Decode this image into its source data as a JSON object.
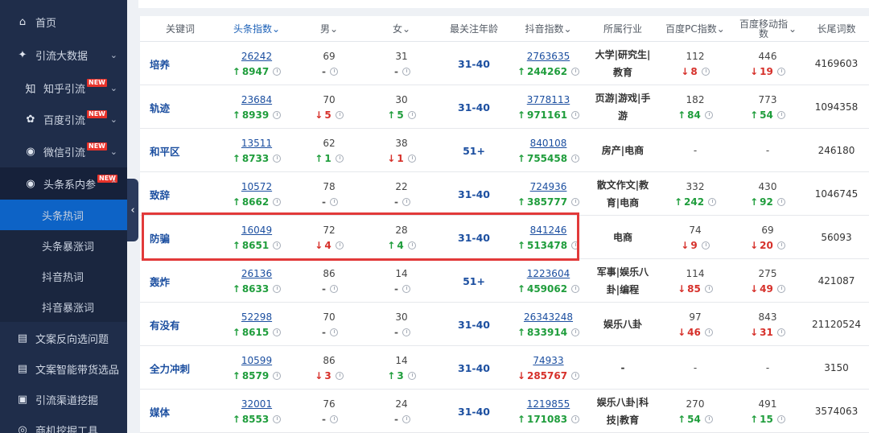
{
  "sidebar": {
    "home": "首页",
    "traffic": "引流大数据",
    "zhihu": "知乎引流",
    "baidu": "百度引流",
    "wechat": "微信引流",
    "toutiao": "头条系内参",
    "new_badge": "NEW",
    "hot": "头条热词",
    "surge": "头条暴涨词",
    "douyin_hot": "抖音热词",
    "douyin_surge": "抖音暴涨词",
    "reverse": "文案反向选问题",
    "smart": "文案智能带货选品",
    "channel": "引流渠道挖掘",
    "biz": "商机挖掘工具"
  },
  "columns": {
    "keyword": "关键词",
    "toutiao": "头条指数",
    "male": "男",
    "female": "女",
    "age": "最关注年龄",
    "douyin": "抖音指数",
    "industry": "所属行业",
    "baidu_pc": "百度PC指数",
    "baidu_mobile": "百度移动指数",
    "longtail": "长尾词数"
  },
  "rows": [
    {
      "kw": "培养",
      "tt": "26242",
      "tt_d": "8947",
      "tt_dir": "up",
      "m": "69",
      "m_d": "-",
      "m_dir": "neutral",
      "f": "31",
      "f_d": "-",
      "f_dir": "neutral",
      "age": "31-40",
      "dy": "2763635",
      "dy_d": "244262",
      "dy_dir": "up",
      "ind": "大学|研究生|教育",
      "pc": "112",
      "pc_d": "8",
      "pc_dir": "down",
      "mo": "446",
      "mo_d": "19",
      "mo_dir": "down",
      "lt": "4169603"
    },
    {
      "kw": "轨迹",
      "tt": "23684",
      "tt_d": "8939",
      "tt_dir": "up",
      "m": "70",
      "m_d": "5",
      "m_dir": "down",
      "f": "30",
      "f_d": "5",
      "f_dir": "up",
      "age": "31-40",
      "dy": "3778113",
      "dy_d": "971161",
      "dy_dir": "up",
      "ind": "页游|游戏|手游",
      "pc": "182",
      "pc_d": "84",
      "pc_dir": "up",
      "mo": "773",
      "mo_d": "54",
      "mo_dir": "up",
      "lt": "1094358"
    },
    {
      "kw": "和平区",
      "tt": "13511",
      "tt_d": "8733",
      "tt_dir": "up",
      "m": "62",
      "m_d": "1",
      "m_dir": "up",
      "f": "38",
      "f_d": "1",
      "f_dir": "down",
      "age": "51+",
      "dy": "840108",
      "dy_d": "755458",
      "dy_dir": "up",
      "ind": "房产|电商",
      "pc": "-",
      "pc_d": "",
      "pc_dir": "none",
      "mo": "-",
      "mo_d": "",
      "mo_dir": "none",
      "lt": "246180"
    },
    {
      "kw": "致辞",
      "tt": "10572",
      "tt_d": "8662",
      "tt_dir": "up",
      "m": "78",
      "m_d": "-",
      "m_dir": "neutral",
      "f": "22",
      "f_d": "-",
      "f_dir": "neutral",
      "age": "31-40",
      "dy": "724936",
      "dy_d": "385777",
      "dy_dir": "up",
      "ind": "散文作文|教育|电商",
      "pc": "332",
      "pc_d": "242",
      "pc_dir": "up",
      "mo": "430",
      "mo_d": "92",
      "mo_dir": "up",
      "lt": "1046745"
    },
    {
      "kw": "防骗",
      "tt": "16049",
      "tt_d": "8651",
      "tt_dir": "up",
      "m": "72",
      "m_d": "4",
      "m_dir": "down",
      "f": "28",
      "f_d": "4",
      "f_dir": "up",
      "age": "31-40",
      "dy": "841246",
      "dy_d": "513478",
      "dy_dir": "up",
      "ind": "电商",
      "pc": "74",
      "pc_d": "9",
      "pc_dir": "down",
      "mo": "69",
      "mo_d": "20",
      "mo_dir": "down",
      "lt": "56093"
    },
    {
      "kw": "轰炸",
      "tt": "26136",
      "tt_d": "8633",
      "tt_dir": "up",
      "m": "86",
      "m_d": "-",
      "m_dir": "neutral",
      "f": "14",
      "f_d": "-",
      "f_dir": "neutral",
      "age": "51+",
      "dy": "1223604",
      "dy_d": "459062",
      "dy_dir": "up",
      "ind": "军事|娱乐八卦|编程",
      "pc": "114",
      "pc_d": "85",
      "pc_dir": "down",
      "mo": "275",
      "mo_d": "49",
      "mo_dir": "down",
      "lt": "421087"
    },
    {
      "kw": "有没有",
      "tt": "52298",
      "tt_d": "8615",
      "tt_dir": "up",
      "m": "70",
      "m_d": "-",
      "m_dir": "neutral",
      "f": "30",
      "f_d": "-",
      "f_dir": "neutral",
      "age": "31-40",
      "dy": "26343248",
      "dy_d": "833914",
      "dy_dir": "up",
      "ind": "娱乐八卦",
      "pc": "97",
      "pc_d": "46",
      "pc_dir": "down",
      "mo": "843",
      "mo_d": "31",
      "mo_dir": "down",
      "lt": "21120524"
    },
    {
      "kw": "全力冲刺",
      "tt": "10599",
      "tt_d": "8579",
      "tt_dir": "up",
      "m": "86",
      "m_d": "3",
      "m_dir": "down",
      "f": "14",
      "f_d": "3",
      "f_dir": "up",
      "age": "31-40",
      "dy": "74933",
      "dy_d": "285767",
      "dy_dir": "down",
      "ind": "-",
      "pc": "-",
      "pc_d": "",
      "pc_dir": "none",
      "mo": "-",
      "mo_d": "",
      "mo_dir": "none",
      "lt": "3150"
    },
    {
      "kw": "媒体",
      "tt": "32001",
      "tt_d": "8553",
      "tt_dir": "up",
      "m": "76",
      "m_d": "-",
      "m_dir": "neutral",
      "f": "24",
      "f_d": "-",
      "f_dir": "neutral",
      "age": "31-40",
      "dy": "1219855",
      "dy_d": "171083",
      "dy_dir": "up",
      "ind": "娱乐八卦|科技|教育",
      "pc": "270",
      "pc_d": "54",
      "pc_dir": "up",
      "mo": "491",
      "mo_d": "15",
      "mo_dir": "up",
      "lt": "3574063"
    }
  ]
}
